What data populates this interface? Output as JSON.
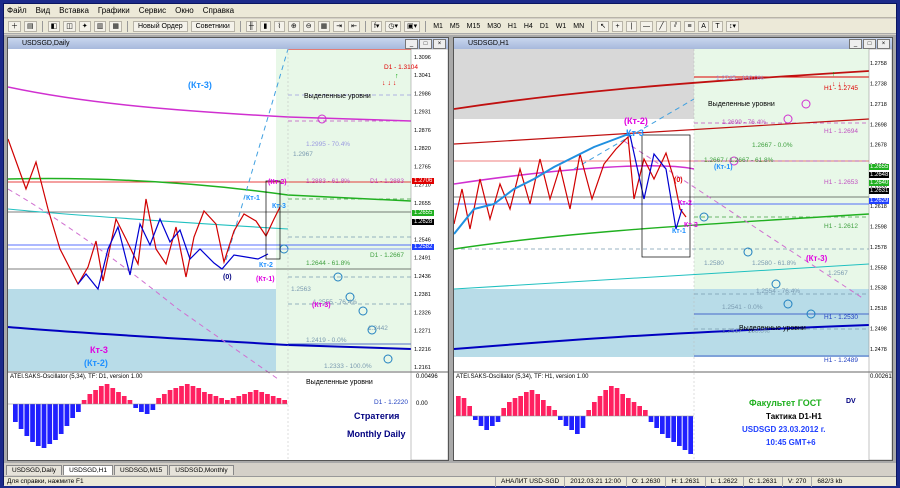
{
  "menu": [
    "Файл",
    "Вид",
    "Вставка",
    "Графики",
    "Сервис",
    "Окно",
    "Справка"
  ],
  "toolbar": {
    "new_order": "Новый Ордер",
    "advisors": "Советники",
    "timeframes": [
      "M1",
      "M5",
      "M15",
      "M30",
      "H1",
      "H4",
      "D1",
      "W1",
      "MN"
    ]
  },
  "left_window": {
    "title": "USDSGD,Daily",
    "price_labels": [
      "1.3096",
      "1.3041",
      "1.2986",
      "1.2931",
      "1.2876",
      "1.2820",
      "1.2765",
      "1.2710",
      "1.2655",
      "1.2600",
      "1.2546",
      "1.2491",
      "1.2436",
      "1.2381",
      "1.2326",
      "1.2271",
      "1.2216",
      "1.2161"
    ],
    "levels": [
      {
        "text": "D1 - 1.3104",
        "color": "#e00000"
      },
      {
        "text": "1.2995 - 70.4%",
        "color": "#9a9ae0"
      },
      {
        "text": "1.2967",
        "color": "#7a9ab0"
      },
      {
        "text": "1.2883 - 61.8%",
        "color": "#c050c0"
      },
      {
        "text": "D1 - 1.2883",
        "color": "#c050c0"
      },
      {
        "text": "D1 - 1.2667",
        "color": "#40a040"
      },
      {
        "text": "1.2644 - 61.8%",
        "color": "#40a040"
      },
      {
        "text": "1.2563",
        "color": "#7a9ab0"
      },
      {
        "text": "1.2555 - 76.4%",
        "color": "#7a9ab0"
      },
      {
        "text": "1.2442",
        "color": "#7a9ab0"
      },
      {
        "text": "1.2419 - 0.0%",
        "color": "#7a9ab0"
      },
      {
        "text": "1.2333 - 100.0%",
        "color": "#7a9ab0"
      },
      {
        "text": "D1 - 1.2220",
        "color": "#2040c0"
      }
    ],
    "badges": [
      "1.2706",
      "1.2655",
      "1.2628",
      "1.2582"
    ],
    "highlight_label": "Выделенные уровни",
    "highlight_label_2": "Выделенные уровни",
    "wave_labels": [
      "(Кт-3)",
      "Кт-1",
      "(Кт-2)",
      "Кт-3",
      "Кт-2",
      "(Кт-1)",
      "(0)",
      "(Кт-3)",
      "Кт-3",
      "(Кт-2)"
    ],
    "osc_title": "ATEI.SAKS-Oscillator (5,34), TF: D1, version 1.00",
    "osc_scale": [
      "0.00496",
      "0.00",
      ""
    ],
    "strategy_line1": "Стратегия",
    "strategy_line2": "Monthly Daily"
  },
  "right_window": {
    "title": "USDSGD,H1",
    "price_labels": [
      "1.2758",
      "1.2738",
      "1.2718",
      "1.2698",
      "1.2678",
      "1.2658",
      "1.2638",
      "1.2618",
      "1.2598",
      "1.2578",
      "1.2558",
      "1.2538",
      "1.2518",
      "1.2498",
      "1.2478"
    ],
    "levels": [
      {
        "text": "1.2745 - 100.0%",
        "color": "#9a9ae0"
      },
      {
        "text": "H1 - 1.2745",
        "color": "#e00000"
      },
      {
        "text": "1.2699 - 76.4%",
        "color": "#c050c0"
      },
      {
        "text": "H1 - 1.2694",
        "color": "#c050c0"
      },
      {
        "text": "1.2667 - 0.0%",
        "color": "#40a040"
      },
      {
        "text": "1.2667 / 1.2667 - 61.8%",
        "color": "#40a040"
      },
      {
        "text": "H1 - 1.2653",
        "color": "#c050c0"
      },
      {
        "text": "H1 - 1.2612",
        "color": "#40a040"
      },
      {
        "text": "1.2580",
        "color": "#7a9ab0"
      },
      {
        "text": "1.2580 - 61.8%",
        "color": "#7a9ab0"
      },
      {
        "text": "1.2567",
        "color": "#7a9ab0"
      },
      {
        "text": "1.2554 - 76.4%",
        "color": "#7a9ab0"
      },
      {
        "text": "1.2541 - 0.0%",
        "color": "#7a9ab0"
      },
      {
        "text": "H1 - 1.2530",
        "color": "#2040c0"
      },
      {
        "text": "1.2517 - 100.0%",
        "color": "#7a9ab0"
      },
      {
        "text": "H1 - 1.2489",
        "color": "#2040c0"
      }
    ],
    "badges": [
      "1.2655",
      "1.2648",
      "1.2640",
      "1.2631",
      "1.2629"
    ],
    "highlight_label": "Выделенные уровни",
    "highlight_label_2": "Выделенные уровни",
    "wave_labels": [
      "(Кт-2)",
      "Кт-3",
      "(Кт-1)",
      "(0)",
      "Кт-2",
      "Кт-1",
      "Кт-3",
      "(Кт-3)"
    ],
    "osc_title": "ATEI.SAKS-Oscillator (5,34), TF: H1, version 1.00",
    "osc_scale": "0.00261",
    "info": {
      "line1": "Факультет ГОСТ",
      "dv": "DV",
      "line2": "Тактика D1-H1",
      "line3": "USDSGD  23.03.2012 г.",
      "line4": "10:45  GMT+6"
    }
  },
  "tabs": [
    "USDSGD,Daily",
    "USDSGD,H1",
    "USDSGD,M15",
    "USDSGD,Monthly"
  ],
  "status": {
    "help": "Для справки, нажмите F1",
    "profile": "АНАЛИТ USD-SGD",
    "time": "2012.03.21 12:00",
    "open": "O: 1.2630",
    "high": "H: 1.2631",
    "low": "L: 1.2622",
    "close": "C: 1.2631",
    "vol": "V: 270",
    "traffic": "682/3 kb"
  },
  "colors": {
    "up": "#e00000",
    "down": "#0000c0",
    "zone_top": "#d8d8d8",
    "zone_bottom": "#b8dce8",
    "zone_right": "#e8f8e8"
  }
}
